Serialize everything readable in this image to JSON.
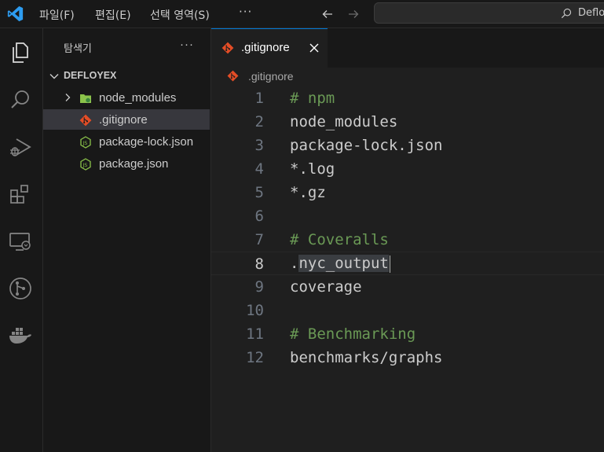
{
  "titlebar": {
    "menu": [
      "파일(F)",
      "편집(E)",
      "선택 영역(S)"
    ],
    "more": "···",
    "search_text": "Deflo"
  },
  "sidebar": {
    "title": "탐색기",
    "more": "···",
    "folder": "DEFLOYEX",
    "items": [
      {
        "label": "node_modules",
        "icon": "folder-icon"
      },
      {
        "label": ".gitignore",
        "icon": "git-icon"
      },
      {
        "label": "package-lock.json",
        "icon": "nodejs-icon"
      },
      {
        "label": "package.json",
        "icon": "nodejs-icon"
      }
    ]
  },
  "editor": {
    "tab_label": ".gitignore",
    "breadcrumb": ".gitignore",
    "current_line": 8,
    "lines": [
      {
        "n": "1",
        "text": "# npm"
      },
      {
        "n": "2",
        "text": "node_modules"
      },
      {
        "n": "3",
        "text": "package-lock.json"
      },
      {
        "n": "4",
        "text": "*.log"
      },
      {
        "n": "5",
        "text": "*.gz"
      },
      {
        "n": "6",
        "text": ""
      },
      {
        "n": "7",
        "text": "# Coveralls"
      },
      {
        "n": "8",
        "text_prefix": ".",
        "text_selected": "nyc_output"
      },
      {
        "n": "9",
        "text": "coverage"
      },
      {
        "n": "10",
        "text": ""
      },
      {
        "n": "11",
        "text": "# Benchmarking"
      },
      {
        "n": "12",
        "text": "benchmarks/graphs"
      }
    ]
  },
  "colors": {
    "accent": "#0078d4",
    "git_icon": "#e44d26",
    "folder_icon": "#8bc34a",
    "comment": "#6a9955"
  }
}
